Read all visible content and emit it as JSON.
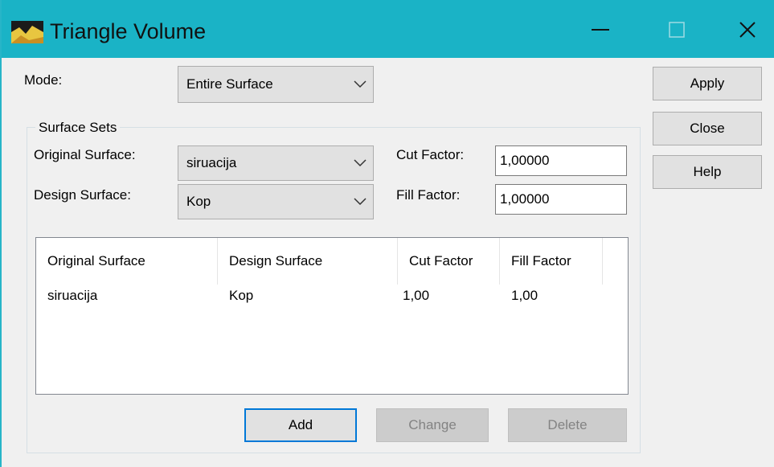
{
  "window": {
    "title": "Triangle Volume"
  },
  "mode": {
    "label": "Mode:",
    "value": "Entire Surface"
  },
  "surface_sets": {
    "legend": "Surface Sets",
    "original_label": "Original Surface:",
    "original_value": "siruacija",
    "design_label": "Design Surface:",
    "design_value": "Kop",
    "cut_label": "Cut Factor:",
    "cut_value": "1,00000",
    "fill_label": "Fill Factor:",
    "fill_value": "1,00000"
  },
  "table": {
    "columns": [
      "Original Surface",
      "Design Surface",
      "Cut Factor",
      "Fill Factor"
    ],
    "rows": [
      [
        "siruacija",
        "Kop",
        "1,00",
        "1,00"
      ]
    ]
  },
  "buttons": {
    "apply": "Apply",
    "close": "Close",
    "help": "Help",
    "add": "Add",
    "change": "Change",
    "delete": "Delete"
  },
  "colors": {
    "titlebar": "#1ab3c6",
    "default_button_border": "#0078d7"
  }
}
